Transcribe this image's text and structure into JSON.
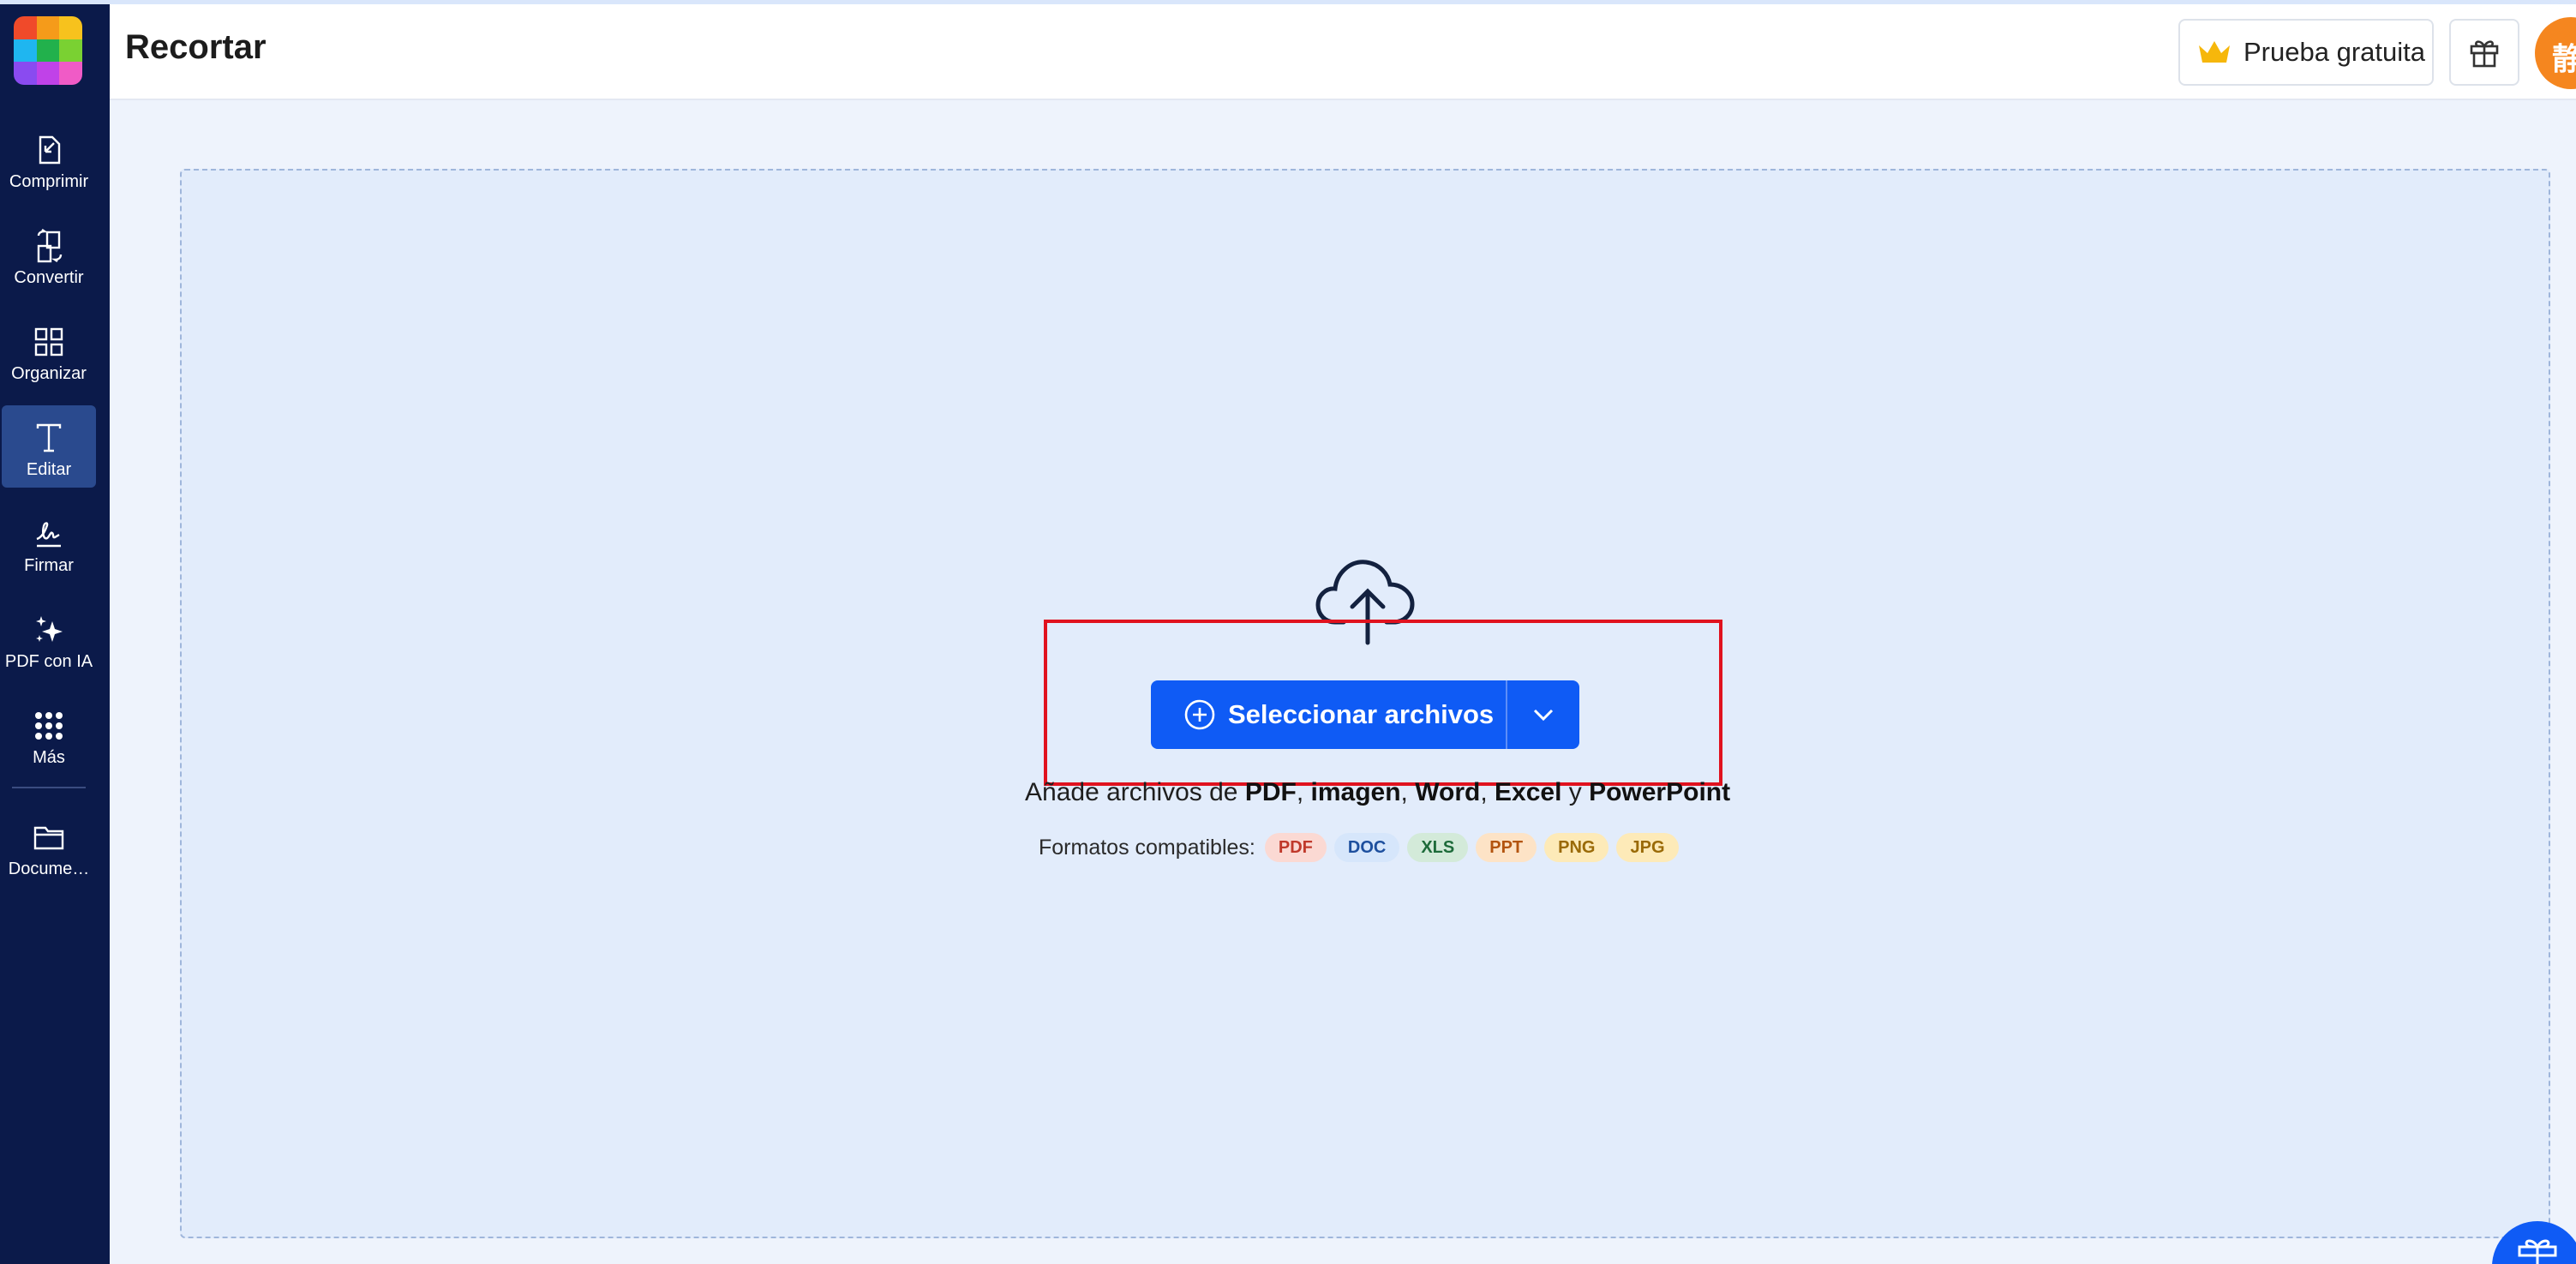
{
  "header": {
    "title": "Recortar",
    "trial_label": "Prueba gratuita",
    "avatar_text": "静香"
  },
  "sidebar": {
    "items": [
      {
        "label": "Comprimir",
        "icon": "compress-icon"
      },
      {
        "label": "Convertir",
        "icon": "convert-icon"
      },
      {
        "label": "Organizar",
        "icon": "organize-icon"
      },
      {
        "label": "Editar",
        "icon": "edit-text-icon",
        "active": true
      },
      {
        "label": "Firmar",
        "icon": "signature-icon"
      },
      {
        "label": "PDF con IA",
        "icon": "sparkles-icon"
      },
      {
        "label": "Más",
        "icon": "apps-grid-icon"
      },
      {
        "label": "Docume…",
        "icon": "folder-icon"
      }
    ]
  },
  "upload": {
    "button_label": "Seleccionar archivos",
    "add_prefix": "Añade archivos de ",
    "add_pdf": "PDF",
    "sep1": ", ",
    "add_image": "imagen",
    "sep2": ", ",
    "add_word": "Word",
    "sep3": ", ",
    "add_excel": "Excel",
    "sep4": " y ",
    "add_ppt": "PowerPoint",
    "formats_label": "Formatos compatibles:",
    "formats": [
      "PDF",
      "DOC",
      "XLS",
      "PPT",
      "PNG",
      "JPG"
    ]
  },
  "colors": {
    "sidebar_bg": "#0b1a4a",
    "accent": "#0f5bf5",
    "highlight": "#e0121e",
    "badge_pdf_bg": "#fbd9d3",
    "badge_pdf_fg": "#c0392b",
    "badge_doc_bg": "#d6e6fb",
    "badge_doc_fg": "#1d4f9e",
    "badge_xls_bg": "#d3ead9",
    "badge_xls_fg": "#1e6b3a",
    "badge_ppt_bg": "#fde3c6",
    "badge_ppt_fg": "#b3540f",
    "badge_png_bg": "#fdeab8",
    "badge_png_fg": "#9a6a07",
    "badge_jpg_bg": "#fdeab8",
    "badge_jpg_fg": "#9a6a07"
  }
}
